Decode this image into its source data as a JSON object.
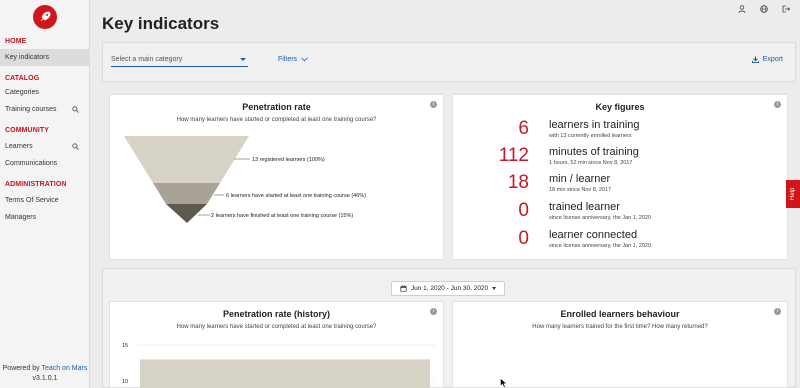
{
  "sidebar": {
    "sections": [
      {
        "title": "HOME",
        "items": [
          {
            "label": "Key indicators"
          }
        ]
      },
      {
        "title": "CATALOG",
        "items": [
          {
            "label": "Categories"
          },
          {
            "label": "Training courses"
          }
        ]
      },
      {
        "title": "COMMUNITY",
        "items": [
          {
            "label": "Learners"
          },
          {
            "label": "Communications"
          }
        ]
      },
      {
        "title": "ADMINISTRATION",
        "items": [
          {
            "label": "Terms Of Service"
          },
          {
            "label": "Managers"
          }
        ]
      }
    ],
    "footer": {
      "powered": "Powered by",
      "brand": "Teach on Mars",
      "version": "v3.1.0.1"
    }
  },
  "page": {
    "title": "Key indicators"
  },
  "filters": {
    "category_placeholder": "Select a main category",
    "filters_label": "Filters",
    "export_label": "Export"
  },
  "penetration": {
    "title": "Penetration rate",
    "subtitle": "How many learners have started or completed at least one training course?",
    "levels": [
      {
        "label": "13 registered learners (100%)",
        "value": 13,
        "percent": 100
      },
      {
        "label": "6 learners have started at least one training course (46%)",
        "value": 6,
        "percent": 46
      },
      {
        "label": "2 learners have finished at least one training course (15%)",
        "value": 2,
        "percent": 15
      }
    ],
    "colors": [
      "#d6d2c6",
      "#a8a396",
      "#5e5a50"
    ]
  },
  "key_figures": {
    "title": "Key figures",
    "rows": [
      {
        "value": "6",
        "label": "learners in training",
        "sub": "with 13 currently enrolled learners"
      },
      {
        "value": "112",
        "label": "minutes of training",
        "sub": "1 hours, 52 min since Nov 8, 2017"
      },
      {
        "value": "18",
        "label": "min / learner",
        "sub": "18 min since Nov 8, 2017"
      },
      {
        "value": "0",
        "label": "trained learner",
        "sub": "since license anniversary, the Jan 1, 2020"
      },
      {
        "value": "0",
        "label": "learner connected",
        "sub": "since license anniversary, the Jan 1, 2020"
      }
    ]
  },
  "date_range": {
    "label": "Jun 1, 2020 - Jun 30, 2020"
  },
  "penetration_history": {
    "title": "Penetration rate (history)",
    "subtitle": "How many learners have started or completed at least one training course?"
  },
  "enrolled": {
    "title": "Enrolled learners behaviour",
    "subtitle": "How many learners trained for the first time? How many returned?"
  },
  "help": {
    "label": "Help"
  },
  "chart_data": {
    "type": "area",
    "title": "Penetration rate (history)",
    "y_ticks": [
      "15",
      "10"
    ],
    "ylim": [
      0,
      15
    ],
    "series": [
      {
        "values": [
          13,
          13
        ]
      }
    ]
  }
}
